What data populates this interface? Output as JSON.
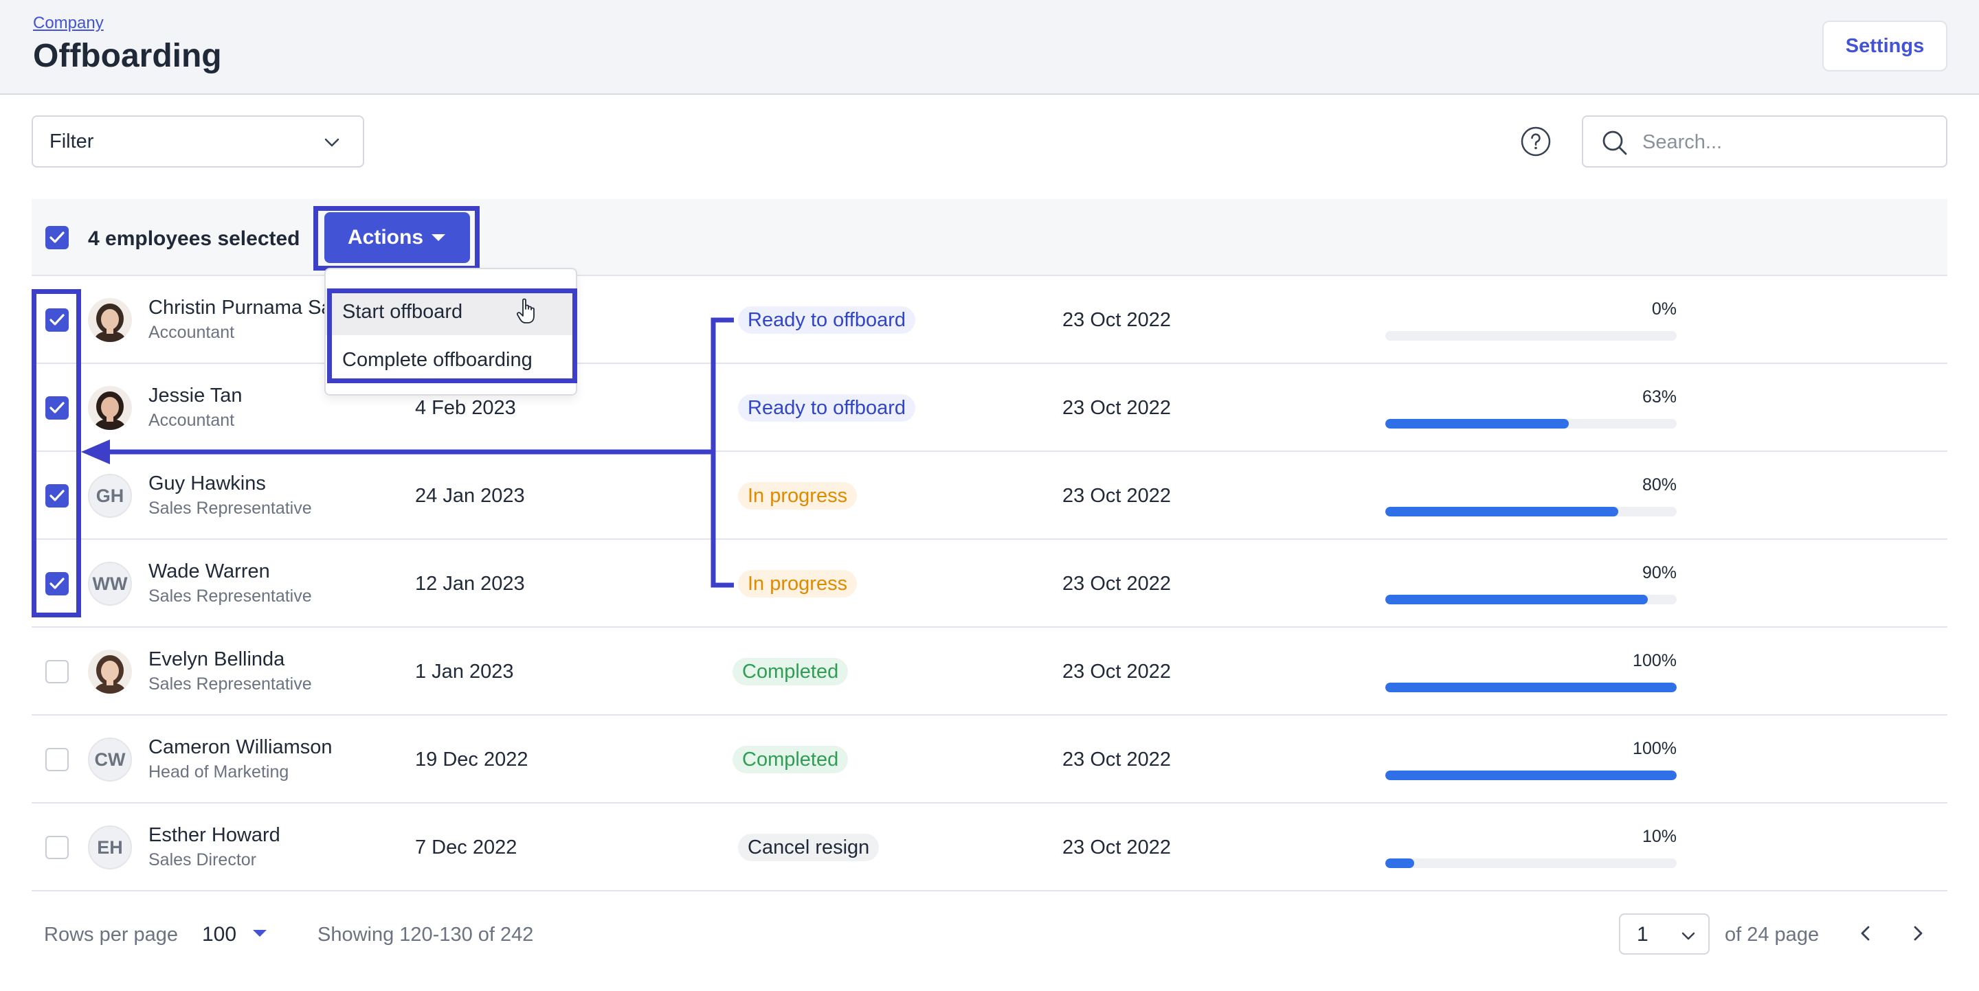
{
  "header": {
    "breadcrumb": "Company",
    "title": "Offboarding",
    "settings_label": "Settings"
  },
  "toolbar": {
    "filter_label": "Filter",
    "search_placeholder": "Search..."
  },
  "selection": {
    "text": "4 employees selected",
    "actions_label": "Actions"
  },
  "actions_menu": {
    "items": [
      "Start offboard",
      "Complete offboarding"
    ],
    "hovered": "Start offboard"
  },
  "employees": [
    {
      "name": "Christin Purnama Sa",
      "role": "Accountant",
      "date": "",
      "status": "Ready to offboard",
      "status_type": "ready",
      "created": "23 Oct 2022",
      "progress": 0,
      "progress_label": "0%",
      "selected": true,
      "avatar": "photo"
    },
    {
      "name": "Jessie Tan",
      "role": "Accountant",
      "date": "4 Feb 2023",
      "status": "Ready to offboard",
      "status_type": "ready",
      "created": "23 Oct 2022",
      "progress": 63,
      "progress_label": "63%",
      "selected": true,
      "avatar": "photo"
    },
    {
      "name": "Guy Hawkins",
      "role": "Sales Representative",
      "date": "24 Jan 2023",
      "status": "In progress",
      "status_type": "progress",
      "created": "23 Oct 2022",
      "progress": 80,
      "progress_label": "80%",
      "selected": true,
      "avatar": "GH"
    },
    {
      "name": "Wade Warren",
      "role": "Sales Representative",
      "date": "12 Jan 2023",
      "status": "In progress",
      "status_type": "progress",
      "created": "23 Oct 2022",
      "progress": 90,
      "progress_label": "90%",
      "selected": true,
      "avatar": "WW"
    },
    {
      "name": "Evelyn Bellinda",
      "role": "Sales Representative",
      "date": "1 Jan 2023",
      "status": "Completed",
      "status_type": "done",
      "created": "23 Oct 2022",
      "progress": 100,
      "progress_label": "100%",
      "selected": false,
      "avatar": "photo"
    },
    {
      "name": "Cameron Williamson",
      "role": "Head of Marketing",
      "date": "19 Dec 2022",
      "status": "Completed",
      "status_type": "done",
      "created": "23 Oct 2022",
      "progress": 100,
      "progress_label": "100%",
      "selected": false,
      "avatar": "CW"
    },
    {
      "name": "Esther Howard",
      "role": "Sales Director",
      "date": "7 Dec 2022",
      "status": "Cancel resign",
      "status_type": "cancel",
      "created": "23 Oct 2022",
      "progress": 10,
      "progress_label": "10%",
      "selected": false,
      "avatar": "EH"
    }
  ],
  "footer": {
    "rows_per_page_label": "Rows per page",
    "rows_per_page_value": "100",
    "showing": "Showing 120-130 of 242",
    "page_value": "1",
    "of_pages": "of 24 page"
  },
  "colors": {
    "accent": "#4253d6",
    "annotation": "#3e3fc8",
    "progress_fill": "#2f6fe8"
  }
}
